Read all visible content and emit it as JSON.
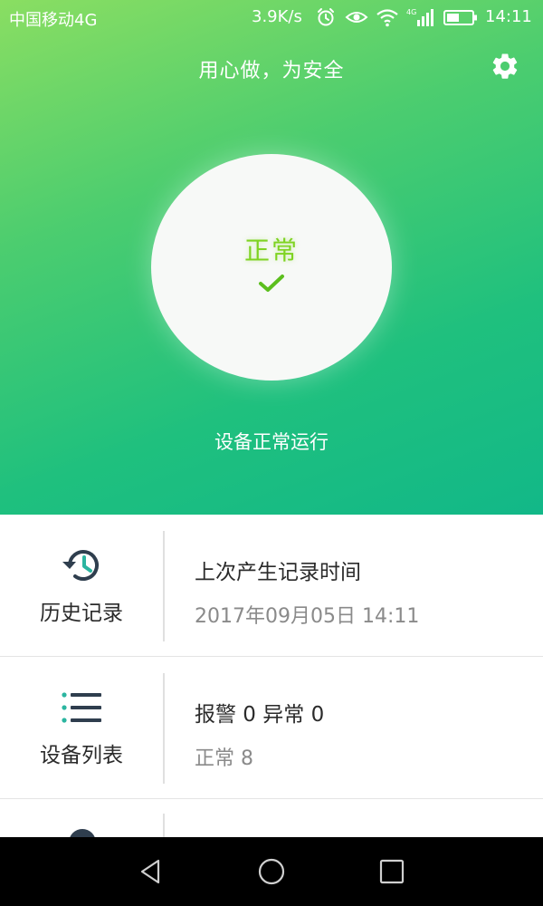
{
  "status_bar": {
    "carrier": "中国移动4G",
    "net_speed": "3.9K/s",
    "time": "14:11",
    "icons": [
      "alarm-icon",
      "eye-icon",
      "wifi-icon",
      "signal-4g-icon",
      "battery-icon"
    ]
  },
  "header": {
    "title": "用心做，为安全",
    "settings_icon": "gear-icon"
  },
  "status": {
    "label": "正常",
    "icon": "check-icon",
    "caption": "设备正常运行",
    "accent_color": "#7ed321"
  },
  "cards": {
    "history": {
      "label": "历史记录",
      "icon": "history-icon",
      "line1": "上次产生记录时间",
      "line2": "2017年09月05日 14:11"
    },
    "devices": {
      "label": "设备列表",
      "icon": "list-icon",
      "line1": "报警 0  异常 0",
      "line2": "正常 8"
    }
  },
  "nav": {
    "icons": [
      "back-icon",
      "home-icon",
      "recents-icon"
    ]
  },
  "colors": {
    "gradient_start": "#8ade62",
    "gradient_end": "#12b888",
    "icon_dark": "#2f3e4e",
    "icon_teal": "#2bb5a0"
  }
}
